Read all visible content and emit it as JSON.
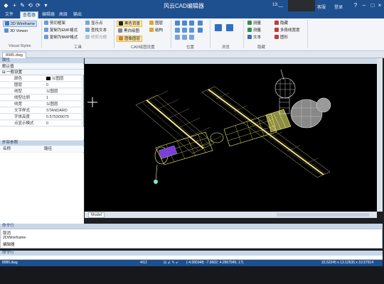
{
  "app": {
    "title": "风云CAD编辑器",
    "clock": "13:__",
    "top_links": [
      "客服",
      "登录"
    ]
  },
  "quick_access": [
    "+",
    "✎",
    "⟲",
    "⟳",
    "▾"
  ],
  "menu": {
    "tabs": [
      {
        "label": "文件",
        "active": false
      },
      {
        "label": "查看器",
        "active": true
      },
      {
        "label": "编辑器",
        "active": false
      },
      {
        "label": "高级",
        "active": false
      },
      {
        "label": "输出",
        "active": false
      }
    ]
  },
  "ribbon": {
    "visual_styles": {
      "items": [
        "2D Wireframe",
        "3D Viewer"
      ],
      "group_label": "Visual Styles"
    },
    "tools": {
      "items": [
        "剪切框架",
        "复制为EMF格式",
        "复制为BMP格式"
      ],
      "items2": [
        "显示点",
        "查找文本",
        "修剪光栅"
      ],
      "group_label": "工具"
    },
    "cad_settings": {
      "items": [
        "黑色背景",
        "黑白绘图",
        "图像图层"
      ],
      "items2": [
        "图层",
        "结构"
      ],
      "group_label": "CAD绘图设置"
    },
    "position": {
      "group_label": "位置"
    },
    "browse": {
      "group_label": "浏览"
    },
    "hide": {
      "items": [
        "测量",
        "测量",
        "文本"
      ],
      "items2": [
        "隐藏",
        "多段线宽度",
        "图形"
      ],
      "group_label": "隐藏"
    }
  },
  "document": {
    "tab": "8985.dwg"
  },
  "properties": {
    "panel_title": "属性",
    "section": "默认值",
    "group": "一般设置",
    "rows": [
      {
        "key": "颜色",
        "value": "以图层",
        "swatch": true
      },
      {
        "key": "图层",
        "value": "0"
      },
      {
        "key": "线型",
        "value": "以图层"
      },
      {
        "key": "线型比例",
        "value": "1"
      },
      {
        "key": "线宽",
        "value": "以图层"
      },
      {
        "key": "文字样式",
        "value": "STANDARD"
      },
      {
        "key": "字体高度",
        "value": "0.575309075"
      },
      {
        "key": "点显示模式",
        "value": "0"
      }
    ]
  },
  "xref": {
    "panel_title": "外部参照",
    "col_name": "名称",
    "col_path": "路径"
  },
  "canvas": {
    "model_tab": "Model"
  },
  "command": {
    "log_title": "命令行",
    "lines": [
      "取消",
      "2DWireframe",
      "编辑器"
    ],
    "input_title": "命令行"
  },
  "status": {
    "file": "8985.dwg",
    "pages": "4/12",
    "coords": "(-4.065948; -7.9602; 4.2667945; 17)",
    "size": "15.52245 x 13.12635 x 10.57914"
  },
  "colors": {
    "accent": "#1e4f8f",
    "canvas": "#000000",
    "model_wire": "#ffff7a",
    "panel_wire": "#d9c98a"
  }
}
